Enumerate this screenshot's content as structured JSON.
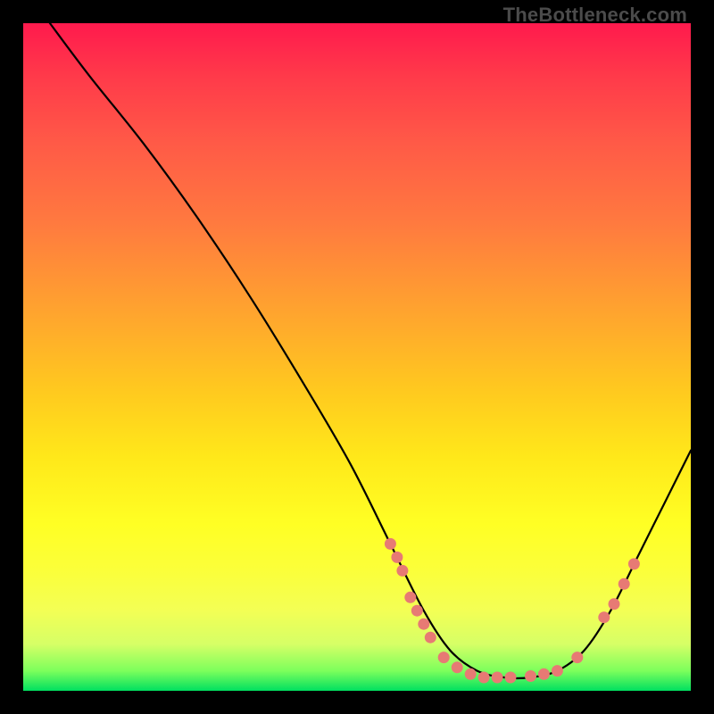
{
  "watermark": "TheBottleneck.com",
  "chart_data": {
    "type": "line",
    "title": "",
    "xlabel": "",
    "ylabel": "",
    "xlim": [
      0,
      100
    ],
    "ylim": [
      0,
      100
    ],
    "series": [
      {
        "name": "curve",
        "x": [
          4,
          10,
          18,
          26,
          34,
          42,
          49,
          55,
          60,
          64,
          68,
          72,
          76,
          80,
          84,
          88,
          92,
          96,
          100
        ],
        "y": [
          100,
          92,
          82,
          71,
          59,
          46,
          34,
          22,
          12,
          6,
          3,
          2,
          2,
          3,
          6,
          12,
          20,
          28,
          36
        ]
      }
    ],
    "markers": [
      {
        "x": 55,
        "y": 22
      },
      {
        "x": 56,
        "y": 20
      },
      {
        "x": 56.8,
        "y": 18
      },
      {
        "x": 58,
        "y": 14
      },
      {
        "x": 59,
        "y": 12
      },
      {
        "x": 60,
        "y": 10
      },
      {
        "x": 61,
        "y": 8
      },
      {
        "x": 63,
        "y": 5
      },
      {
        "x": 65,
        "y": 3.5
      },
      {
        "x": 67,
        "y": 2.5
      },
      {
        "x": 69,
        "y": 2
      },
      {
        "x": 71,
        "y": 2
      },
      {
        "x": 73,
        "y": 2
      },
      {
        "x": 76,
        "y": 2.2
      },
      {
        "x": 78,
        "y": 2.5
      },
      {
        "x": 80,
        "y": 3
      },
      {
        "x": 83,
        "y": 5
      },
      {
        "x": 87,
        "y": 11
      },
      {
        "x": 88.5,
        "y": 13
      },
      {
        "x": 90,
        "y": 16
      },
      {
        "x": 91.5,
        "y": 19
      }
    ],
    "marker_color": "#e77a74",
    "curve_color": "#000000"
  }
}
